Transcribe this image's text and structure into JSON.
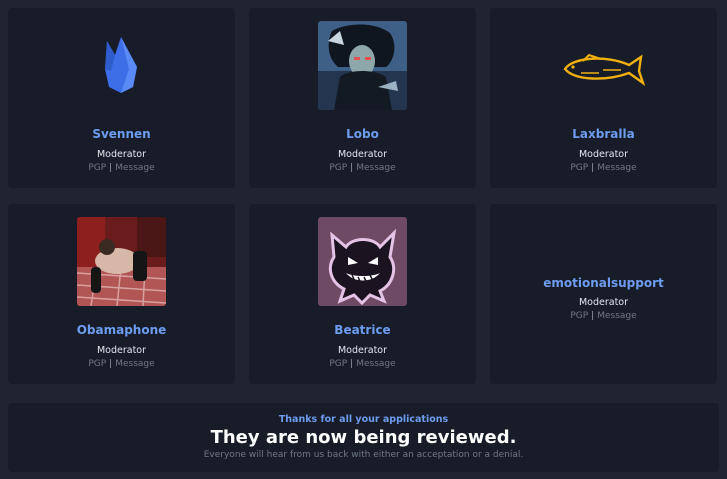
{
  "members": [
    {
      "name": "Svennen",
      "role": "Moderator",
      "pgp": "PGP",
      "message": "Message",
      "avatar_icon": "firebase-logo-icon"
    },
    {
      "name": "Lobo",
      "role": "Moderator",
      "pgp": "PGP",
      "message": "Message",
      "avatar_icon": "lobo-character-avatar"
    },
    {
      "name": "Laxbralla",
      "role": "Moderator",
      "pgp": "PGP",
      "message": "Message",
      "avatar_icon": "fish-outline-icon"
    },
    {
      "name": "Obamaphone",
      "role": "Moderator",
      "pgp": "PGP",
      "message": "Message",
      "avatar_icon": "photo-avatar"
    },
    {
      "name": "Beatrice",
      "role": "Moderator",
      "pgp": "PGP",
      "message": "Message",
      "avatar_icon": "ghost-creature-avatar"
    },
    {
      "name": "emotionalsupport",
      "role": "Moderator",
      "pgp": "PGP",
      "message": "Message",
      "avatar_icon": null
    }
  ],
  "separator": "|",
  "banner": {
    "kicker": "Thanks for all your applications",
    "headline": "They are now being reviewed.",
    "subtext": "Everyone will hear from us back with either an acceptation or a denial."
  },
  "colors": {
    "background": "#1f2430",
    "card": "#171c28",
    "accent": "#6d9cf0",
    "muted": "#6f7787"
  }
}
